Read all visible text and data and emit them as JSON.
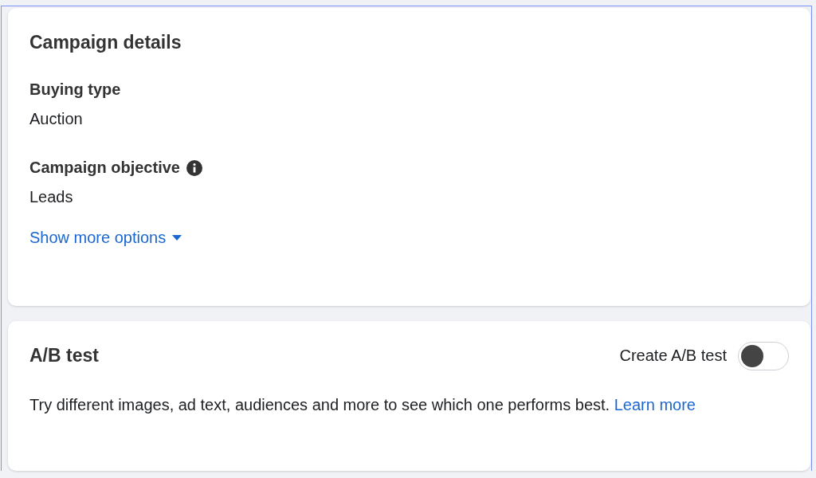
{
  "campaign_details": {
    "title": "Campaign details",
    "fields": [
      {
        "label": "Buying type",
        "value": "Auction",
        "info": false
      },
      {
        "label": "Campaign objective",
        "value": "Leads",
        "info": true
      }
    ],
    "show_more": {
      "label": "Show more options",
      "expanded": false
    }
  },
  "ab_test": {
    "title": "A/B test",
    "toggle": {
      "label": "Create A/B test",
      "on": false
    },
    "description": "Try different images, ad text, audiences and more to see which one performs best.",
    "link": "Learn more"
  }
}
